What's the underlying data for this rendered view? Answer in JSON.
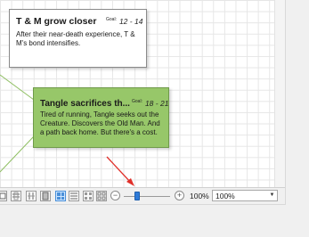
{
  "cards": [
    {
      "title": "T & M grow closer",
      "goal_label": "Goal:",
      "goal_value": "12 - 14",
      "body": "After their near-death experience, T & M's bond intensifies."
    },
    {
      "title": "Tangle sacrifices th...",
      "goal_label": "Goal:",
      "goal_value": "18 - 21",
      "body": "Tired of running, Tangle seeks out the Creature. Discovers the Old Man. And a path back home. But there's a cost.",
      "color": "#97c769"
    }
  ],
  "statusbar": {
    "view_buttons": [
      "view-mode-1",
      "view-mode-2",
      "view-mode-3",
      "view-mode-4",
      "view-mode-5",
      "view-mode-6",
      "view-mode-7"
    ],
    "active_view": 3,
    "zoom_out_symbol": "−",
    "zoom_in_symbol": "+",
    "zoom_slider_level": 0.25,
    "zoom_label": "100%",
    "zoom_select_value": "100%",
    "zoom_select_arrow": "▼"
  },
  "annotation": {
    "color": "#e0302a"
  },
  "colors": {
    "slider_accent": "#2f7bd8",
    "connector": "#8fbf63"
  }
}
